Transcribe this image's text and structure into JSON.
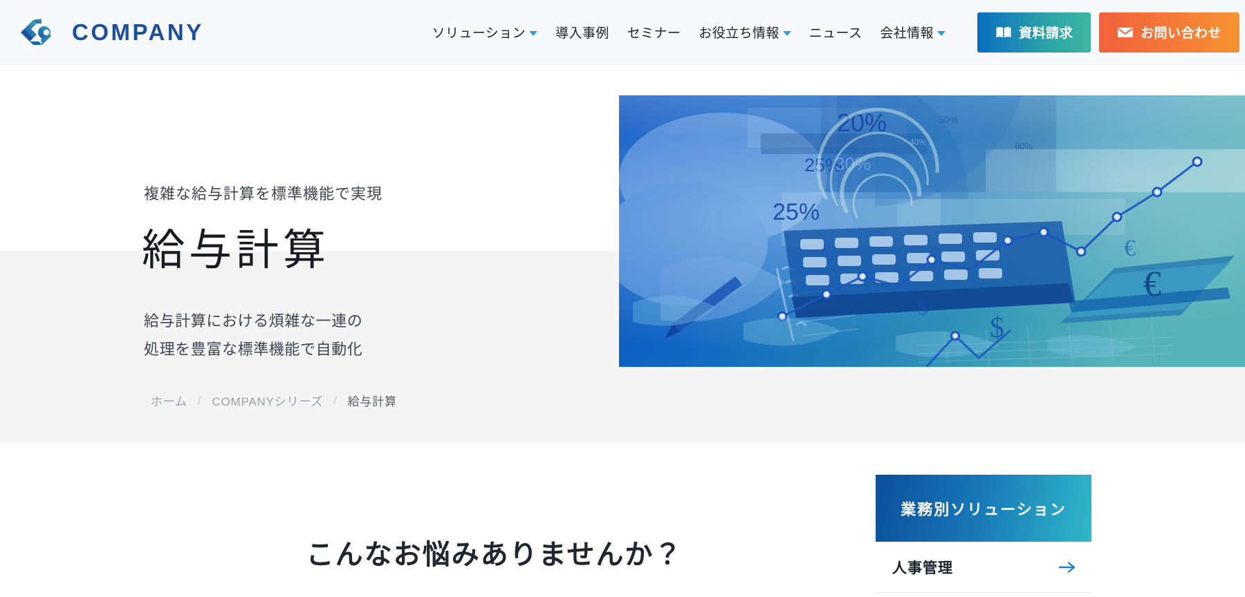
{
  "header": {
    "brand": {
      "name": "COMPANY",
      "logo_icon": "company-chain-logo-icon"
    },
    "nav": [
      {
        "label": "ソリューション",
        "has_dropdown": true
      },
      {
        "label": "導入事例",
        "has_dropdown": false
      },
      {
        "label": "セミナー",
        "has_dropdown": false
      },
      {
        "label": "お役立ち情報",
        "has_dropdown": true
      },
      {
        "label": "ニュース",
        "has_dropdown": false
      },
      {
        "label": "会社情報",
        "has_dropdown": true
      }
    ],
    "buttons": {
      "document_request": {
        "label": "資料請求",
        "icon": "book-icon",
        "gradient_from": "#0a6ec0",
        "gradient_to": "#3cb69f"
      },
      "contact": {
        "label": "お問い合わせ",
        "icon": "mail-icon",
        "gradient_from": "#f2603c",
        "gradient_to": "#f59331"
      }
    }
  },
  "hero": {
    "kicker": "複雑な給与計算を標準機能で実現",
    "title": "給与計算",
    "description_line1": "給与計算における煩雑な一連の",
    "description_line2": "処理を豊富な標準機能で自動化",
    "image_alt": "ビジネスデータ分析イメージ",
    "image_labels": [
      "20%",
      "25%",
      "25%",
      "30%",
      "50%",
      "60%"
    ],
    "image_currency_symbols": [
      "€",
      "$",
      "$",
      "€"
    ],
    "background_band_color": "#f4f4f4"
  },
  "breadcrumb": {
    "items": [
      {
        "label": "ホーム",
        "current": false
      },
      {
        "label": "COMPANYシリーズ",
        "current": false
      },
      {
        "label": "給与計算",
        "current": true
      }
    ],
    "separator": "/"
  },
  "main": {
    "section_heading": "こんなお悩みありませんか？"
  },
  "sidebar": {
    "header_label": "業務別ソリューション",
    "header_gradient_from": "#0d4f9c",
    "header_gradient_to": "#2fb8c8",
    "items": [
      {
        "label": "人事管理",
        "icon": "arrow-right-icon"
      }
    ]
  },
  "colors": {
    "brand_blue": "#1a4f9c",
    "accent_cyan": "#2a9fd6",
    "accent_orange": "#f2603c",
    "header_bg": "#f7f9fb",
    "text_dark": "#20262e"
  }
}
